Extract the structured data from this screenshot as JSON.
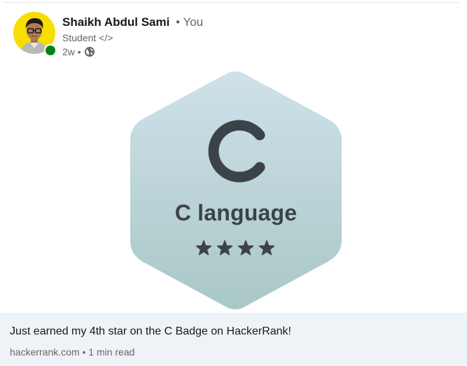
{
  "post": {
    "author": {
      "name": "Shaikh Abdul Sami",
      "you_label": "• You",
      "headline": "Student </>",
      "time": "2w •",
      "avatar_icon": "avatar-photo",
      "presence": "online",
      "visibility_icon": "globe-icon"
    },
    "badge": {
      "letter": "C",
      "title": "C language",
      "stars": 4,
      "star_color": "#3d4249",
      "hex_color_top": "#cde0e8",
      "hex_color_bottom": "#a9c6c7"
    },
    "link_card": {
      "title": "Just earned my 4th star on the C Badge on HackerRank!",
      "subtitle": "hackerrank.com • 1 min read"
    }
  }
}
